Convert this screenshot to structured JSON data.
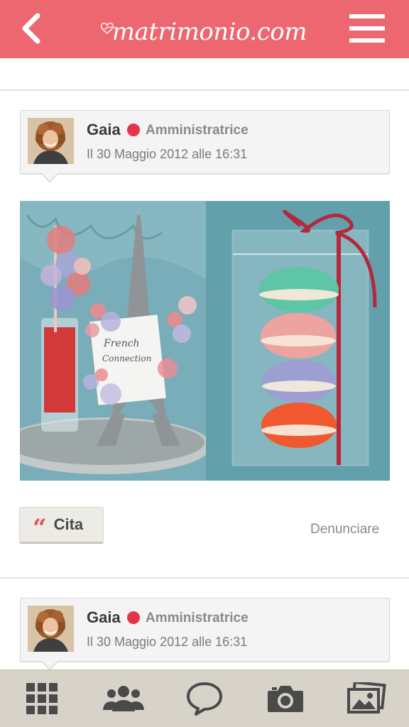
{
  "header": {
    "brand": "matrimonio.com",
    "background": "#ec6770"
  },
  "posts": [
    {
      "author": "Gaia",
      "role": "Amministratrice",
      "date": "Il 30 Maggio 2012 alle 16:31",
      "actions": {
        "cite_label": "Cita",
        "report_label": "Denunciare"
      }
    },
    {
      "author": "Gaia",
      "role": "Amministratrice",
      "date": "Il 30 Maggio 2012 alle 16:31"
    }
  ],
  "tabbar": {
    "items": [
      "grid-icon",
      "users-icon",
      "chat-bubble-icon",
      "camera-icon",
      "photos-icon"
    ]
  },
  "colors": {
    "accent": "#ec6770",
    "online": "#e8324a",
    "tabbar": "#d8d3c9"
  }
}
